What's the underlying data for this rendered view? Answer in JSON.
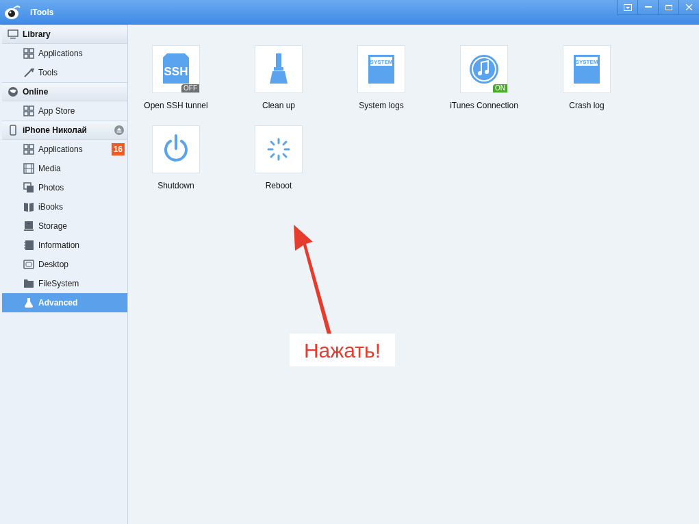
{
  "window": {
    "title": "iTools"
  },
  "sidebar": [
    {
      "label": "Library",
      "eject": false,
      "items": [
        {
          "label": "Applications",
          "selected": false
        },
        {
          "label": "Tools",
          "selected": false
        }
      ]
    },
    {
      "label": "Online",
      "eject": false,
      "items": [
        {
          "label": "App Store",
          "selected": false
        }
      ]
    },
    {
      "label": "iPhone Николай",
      "eject": true,
      "items": [
        {
          "label": "Applications",
          "selected": false,
          "badge": "16"
        },
        {
          "label": "Media",
          "selected": false
        },
        {
          "label": "Photos",
          "selected": false
        },
        {
          "label": "iBooks",
          "selected": false
        },
        {
          "label": "Storage",
          "selected": false
        },
        {
          "label": "Information",
          "selected": false
        },
        {
          "label": "Desktop",
          "selected": false
        },
        {
          "label": "FileSystem",
          "selected": false
        },
        {
          "label": "Advanced",
          "selected": true
        }
      ]
    }
  ],
  "tools": [
    {
      "label": "Open SSH tunnel",
      "icon_text": "SSH",
      "badge": {
        "text": "OFF",
        "on": false
      }
    },
    {
      "label": "Clean up"
    },
    {
      "label": "System logs",
      "icon_text": "SYSTEM"
    },
    {
      "label": "iTunes Connection",
      "badge": {
        "text": "ON",
        "on": true
      }
    },
    {
      "label": "Crash log",
      "icon_text": "SYSTEM"
    },
    {
      "label": "Shutdown"
    },
    {
      "label": "Reboot"
    }
  ],
  "annotation": {
    "text": "Нажать!"
  }
}
